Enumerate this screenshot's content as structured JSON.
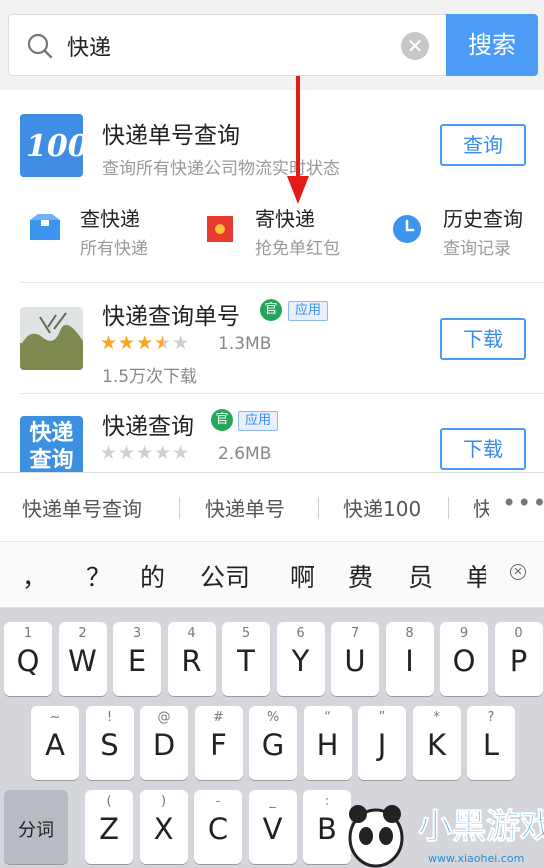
{
  "search": {
    "query": "快递",
    "clear_icon": "close-circle-icon",
    "button_label": "搜索"
  },
  "card1": {
    "title": "快递单号查询",
    "subtitle": "查询所有快递公司物流实时状态",
    "button_label": "查询",
    "icon_text": "100",
    "quick_links": [
      {
        "title": "查快递",
        "sub": "所有快递",
        "icon": "box-icon"
      },
      {
        "title": "寄快递",
        "sub": "抢免单红包",
        "icon": "red-envelope-icon"
      },
      {
        "title": "历史查询",
        "sub": "查询记录",
        "icon": "clock-icon"
      }
    ]
  },
  "apps": [
    {
      "title": "快递查询单号",
      "badge_official": "官",
      "badge_app": "应用",
      "rating": 3.5,
      "size": "1.3MB",
      "downloads": "1.5万次下载",
      "button_label": "下载"
    },
    {
      "title": "快递查询",
      "badge_official": "官",
      "badge_app": "应用",
      "rating": 0,
      "size": "2.6MB",
      "button_label": "下载",
      "icon_text_1": "快递",
      "icon_text_2": "查询"
    }
  ],
  "suggestions": [
    "快递单号查询",
    "快递单号",
    "快递100",
    "快"
  ],
  "suggest_more": "•••",
  "candidates": [
    "，",
    "？",
    "的",
    "公司",
    "啊",
    "费",
    "员",
    "单"
  ],
  "keyboard": {
    "row1": [
      {
        "n": "1",
        "c": "Q"
      },
      {
        "n": "2",
        "c": "W"
      },
      {
        "n": "3",
        "c": "E"
      },
      {
        "n": "4",
        "c": "R"
      },
      {
        "n": "5",
        "c": "T"
      },
      {
        "n": "6",
        "c": "Y"
      },
      {
        "n": "7",
        "c": "U"
      },
      {
        "n": "8",
        "c": "I"
      },
      {
        "n": "9",
        "c": "O"
      },
      {
        "n": "0",
        "c": "P"
      }
    ],
    "row2": [
      {
        "n": "~",
        "c": "A"
      },
      {
        "n": "!",
        "c": "S"
      },
      {
        "n": "@",
        "c": "D"
      },
      {
        "n": "#",
        "c": "F"
      },
      {
        "n": "%",
        "c": "G"
      },
      {
        "n": "“",
        "c": "H"
      },
      {
        "n": "”",
        "c": "J"
      },
      {
        "n": "*",
        "c": "K"
      },
      {
        "n": "?",
        "c": "L"
      }
    ],
    "row3": [
      {
        "n": "(",
        "c": "Z"
      },
      {
        "n": ")",
        "c": "X"
      },
      {
        "n": "-",
        "c": "C"
      },
      {
        "n": "_",
        "c": "V"
      },
      {
        "n": ":",
        "c": "B"
      }
    ],
    "fn_key": "分词"
  },
  "watermark": {
    "text": "小黑游戏",
    "url": "www.xiaohei.com"
  },
  "colors": {
    "accent": "#4a9cf6",
    "star": "#f6a623",
    "arrow": "#e41b1b",
    "official_badge": "#26a65b"
  }
}
